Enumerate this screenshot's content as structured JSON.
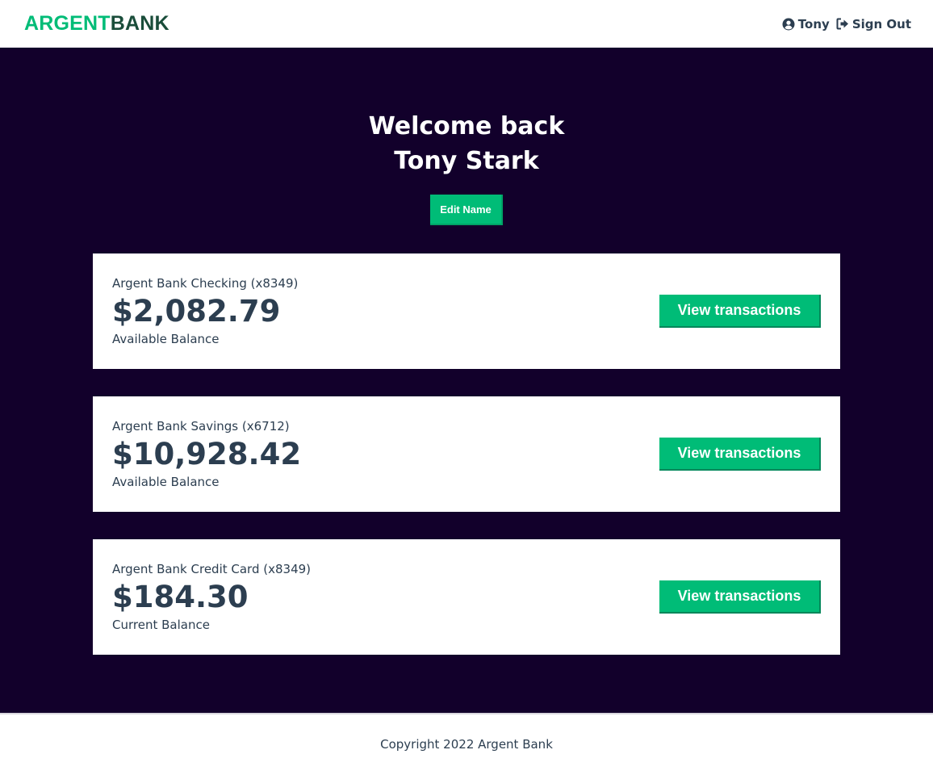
{
  "brand": {
    "logo_part1": "ARGENT",
    "logo_part2": "BANK",
    "colors": {
      "primary": "#00bc77",
      "dark": "#12002b",
      "text": "#2c3e50"
    }
  },
  "nav": {
    "user_label": "Tony",
    "user_icon": "user-circle-icon",
    "signout_label": "Sign Out",
    "signout_icon": "sign-out-icon"
  },
  "header": {
    "line1": "Welcome back",
    "line2": "Tony Stark",
    "edit_label": "Edit Name"
  },
  "accounts": [
    {
      "title": "Argent Bank Checking (x8349)",
      "amount": "$2,082.79",
      "description": "Available Balance",
      "button_label": "View transactions"
    },
    {
      "title": "Argent Bank Savings (x6712)",
      "amount": "$10,928.42",
      "description": "Available Balance",
      "button_label": "View transactions"
    },
    {
      "title": "Argent Bank Credit Card (x8349)",
      "amount": "$184.30",
      "description": "Current Balance",
      "button_label": "View transactions"
    }
  ],
  "footer": {
    "copyright": "Copyright 2022 Argent Bank"
  }
}
